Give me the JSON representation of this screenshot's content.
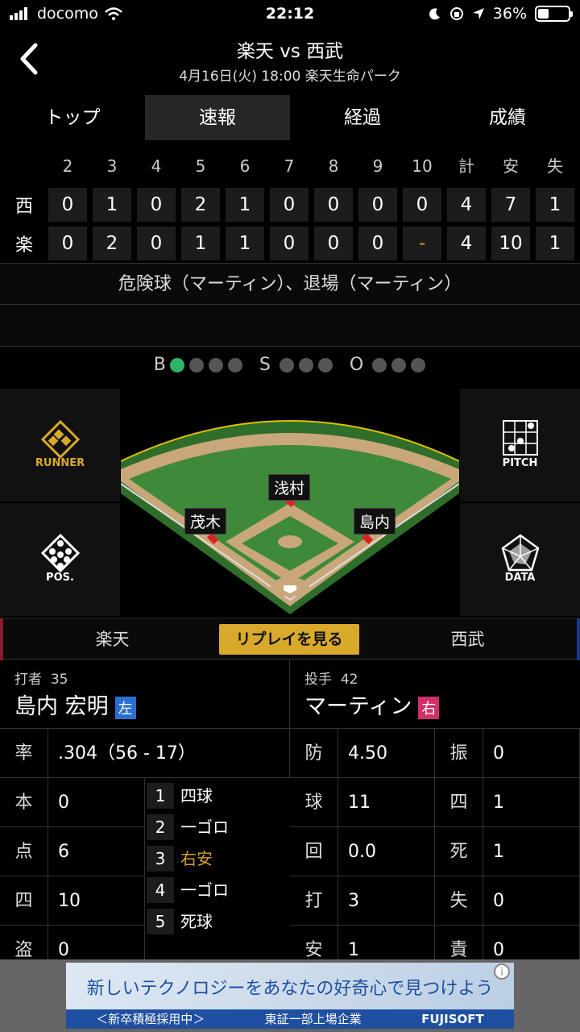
{
  "status": {
    "carrier": "docomo",
    "time": "22:12",
    "battery": "36%"
  },
  "header": {
    "title": "楽天 vs 西武",
    "subtitle": "4月16日(火) 18:00 楽天生命パーク"
  },
  "tabs": [
    "トップ",
    "速報",
    "経過",
    "成績"
  ],
  "scoreboard": {
    "cols": [
      "2",
      "3",
      "4",
      "5",
      "6",
      "7",
      "8",
      "9",
      "10",
      "計",
      "安",
      "失"
    ],
    "teams": [
      {
        "abbr": "西",
        "vals": [
          "0",
          "1",
          "0",
          "2",
          "1",
          "0",
          "0",
          "0",
          "0",
          "4",
          "7",
          "1"
        ]
      },
      {
        "abbr": "楽",
        "vals": [
          "0",
          "2",
          "0",
          "1",
          "1",
          "0",
          "0",
          "0",
          "-",
          "4",
          "10",
          "1"
        ]
      }
    ]
  },
  "event": "危険球（マーティン）、退場（マーティン）",
  "count": {
    "b": "B",
    "s": "S",
    "o": "O",
    "balls": 1,
    "strikes": 0,
    "outs": 0
  },
  "field": {
    "runners": [
      "浅村",
      "茂木",
      "島内"
    ],
    "buttons": [
      "RUNNER",
      "PITCH",
      "POS.",
      "DATA"
    ]
  },
  "teambar": {
    "home": "楽天",
    "away": "西武",
    "replay": "リプレイを見る"
  },
  "batter": {
    "role": "打者",
    "num": "35",
    "name": "島内 宏明",
    "hand": "左"
  },
  "pitcher": {
    "role": "投手",
    "num": "42",
    "name": "マーティン",
    "hand": "右"
  },
  "batterStats": {
    "rate_k": "率",
    "rate_v": ".304（56 - 17）",
    "rows": [
      {
        "k": "本",
        "v": "0"
      },
      {
        "k": "点",
        "v": "6"
      },
      {
        "k": "四",
        "v": "10"
      },
      {
        "k": "盗",
        "v": "0"
      }
    ]
  },
  "atbats": [
    {
      "n": "1",
      "r": "四球"
    },
    {
      "n": "2",
      "r": "一ゴロ"
    },
    {
      "n": "3",
      "r": "右安"
    },
    {
      "n": "4",
      "r": "一ゴロ"
    },
    {
      "n": "5",
      "r": "死球"
    }
  ],
  "pitcherStats": [
    {
      "k1": "防",
      "v1": "4.50",
      "k2": "振",
      "v2": "0"
    },
    {
      "k1": "球",
      "v1": "11",
      "k2": "四",
      "v2": "1"
    },
    {
      "k1": "回",
      "v1": "0.0",
      "k2": "死",
      "v2": "1"
    },
    {
      "k1": "打",
      "v1": "3",
      "k2": "失",
      "v2": "0"
    },
    {
      "k1": "安",
      "v1": "1",
      "k2": "責",
      "v2": "0"
    }
  ],
  "ad": {
    "headline": "新しいテクノロジーをあなたの好奇心で見つけよう",
    "left": "＜新卒積極採用中＞",
    "mid": "東証一部上場企業",
    "brand": "FUJISOFT"
  },
  "colors": {
    "accent": "#d9a92b",
    "ball": "#2db36a",
    "field": "#3f8a3a",
    "dirt": "#c9a77a",
    "hit": "#d4a02e"
  }
}
